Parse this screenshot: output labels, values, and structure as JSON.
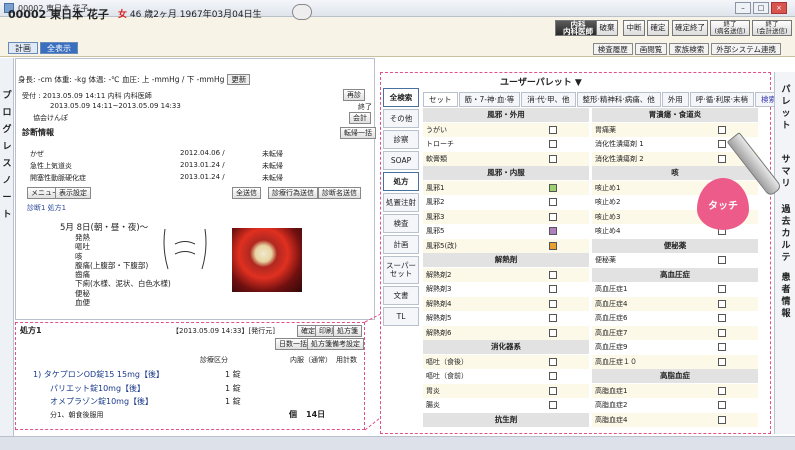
{
  "window": {
    "title": "00002 東日本 花子"
  },
  "patient": {
    "id_name": "00002 東日本 花子",
    "sex": "女",
    "age_dob": "46 歳2ヶ月 1967年03月04日生"
  },
  "top_tabs": [
    "計画",
    "全表示"
  ],
  "toolbar": {
    "b0": "内科\n内科医師",
    "b1": "破棄",
    "b2": "中断",
    "b3": "確定",
    "b4": "確定終了",
    "b5": "終了\n(病名送信)",
    "b6": "終了\n(会計送信)"
  },
  "ext_buttons": [
    "検査履歴",
    "画閲覧",
    "家族検索",
    "外部システム連携"
  ],
  "left_strip": "プログレスノート",
  "vitals": {
    "text": "身長: -cm  体重: -kg  体温: -℃  血圧: 上 -mmHg / 下 -mmHg",
    "update": "更新"
  },
  "visit": {
    "line1": "受付 : 2013.05.09 14:11   内科   内科医師",
    "line2": "2013.05.09 14:11~2013.05.09 14:33",
    "line3": "協会けんぽ",
    "end": "終了",
    "kaikei": "会計",
    "prev": "再診"
  },
  "diag": {
    "title": "診断情報",
    "transfer": "転帰一括",
    "rows": [
      {
        "name": "かぜ",
        "date": "2012.04.06 /",
        "status": "未転帰"
      },
      {
        "name": "急性上気道炎",
        "date": "2013.01.24 /",
        "status": "未転帰"
      },
      {
        "name": "開塞性動脈硬化症",
        "date": "2013.01.24 /",
        "status": "未転帰"
      }
    ],
    "send": [
      "メニュー",
      "表示設定",
      "全送信",
      "診療行為送信",
      "診断名送信"
    ],
    "tabs": "診断1  処方1"
  },
  "note": {
    "date": "5月 8日(朝・昼・夜)～",
    "items": [
      "発熱",
      "嘔吐",
      "咳",
      "腹痛(上腹部・下腹部)",
      "齒痛",
      "下痢(水様、泥状、白色水様)",
      "便秘",
      "血便"
    ]
  },
  "rx": {
    "title": "処方1",
    "stamp": "【2013.05.09 14:33】[発行元]",
    "buttons": [
      "確定",
      "印刷",
      "処方箋"
    ],
    "buttons2": [
      "日数一括",
      "処方箋備考設定"
    ],
    "header": [
      "診療区分",
      "内服（通常）",
      "用計数"
    ],
    "lines": [
      {
        "name": "1) タケプロンOD錠15  15mg【後】",
        "qty": "1 錠"
      },
      {
        "name": "パリエット錠10mg【後】",
        "qty": "1 錠"
      },
      {
        "name": "オメプラゾン錠10mg【後】",
        "qty": "1 錠"
      },
      {
        "name": "分1、朝食後服用",
        "qty": "14日"
      }
    ],
    "unit": "個"
  },
  "palette": {
    "title": "ユーザーパレット ▼"
  },
  "side_menu": [
    "全検索",
    "その他",
    "診察",
    "SOAP",
    "処方",
    "処置注射",
    "検査",
    "計画",
    "スーパーセット",
    "文書",
    "TL"
  ],
  "palette_tabs": [
    "セット",
    "筋・7-神·血·等",
    "消·代·甲、他",
    "整形·精神科·病痛、他",
    "外用",
    "呼·循·利尿·末梢",
    "検索"
  ],
  "left_col": [
    {
      "t": "hdr",
      "label": "風邪・外用"
    },
    {
      "t": "row",
      "label": "うがい",
      "cb": ""
    },
    {
      "t": "row",
      "label": "トローチ",
      "cb": ""
    },
    {
      "t": "row",
      "label": "軟膏類",
      "cb": ""
    },
    {
      "t": "hdr",
      "label": "風邪・内服"
    },
    {
      "t": "row",
      "label": "風邪1",
      "cb": "green"
    },
    {
      "t": "row",
      "label": "風邪2",
      "cb": ""
    },
    {
      "t": "row",
      "label": "風邪3",
      "cb": ""
    },
    {
      "t": "row",
      "label": "風邪5",
      "cb": "purple"
    },
    {
      "t": "row",
      "label": "風邪5(改)",
      "cb": "orange"
    },
    {
      "t": "hdr",
      "label": "解熱剤"
    },
    {
      "t": "row",
      "label": "解熱剤2",
      "cb": ""
    },
    {
      "t": "row",
      "label": "解熱剤3",
      "cb": ""
    },
    {
      "t": "row",
      "label": "解熱剤4",
      "cb": ""
    },
    {
      "t": "row",
      "label": "解熱剤5",
      "cb": ""
    },
    {
      "t": "row",
      "label": "解熱剤6",
      "cb": ""
    },
    {
      "t": "hdr",
      "label": "消化器系"
    },
    {
      "t": "row",
      "label": "嘔吐（食後）",
      "cb": ""
    },
    {
      "t": "row",
      "label": "嘔吐（食前）",
      "cb": ""
    },
    {
      "t": "row",
      "label": "胃炎",
      "cb": ""
    },
    {
      "t": "row",
      "label": "腸炎",
      "cb": ""
    },
    {
      "t": "hdr",
      "label": "抗生剤"
    }
  ],
  "right_col": [
    {
      "t": "hdr",
      "label": "胃潰瘍・食道炎"
    },
    {
      "t": "row",
      "label": "胃痛薬",
      "cb": ""
    },
    {
      "t": "row",
      "label": "消化性潰瘍剤 1",
      "cb": ""
    },
    {
      "t": "row",
      "label": "消化性潰瘍剤 2",
      "cb": ""
    },
    {
      "t": "hdr",
      "label": "咳"
    },
    {
      "t": "row",
      "label": "咳止め1",
      "cb": ""
    },
    {
      "t": "row",
      "label": "咳止め2",
      "cb": ""
    },
    {
      "t": "row",
      "label": "咳止め3",
      "cb": ""
    },
    {
      "t": "row",
      "label": "咳止め4",
      "cb": ""
    },
    {
      "t": "hdr",
      "label": "便秘薬"
    },
    {
      "t": "row",
      "label": "便秘薬",
      "cb": ""
    },
    {
      "t": "hdr",
      "label": "高血圧症"
    },
    {
      "t": "row",
      "label": "高血圧症1",
      "cb": ""
    },
    {
      "t": "row",
      "label": "高血圧症4",
      "cb": ""
    },
    {
      "t": "row",
      "label": "高血圧症6",
      "cb": ""
    },
    {
      "t": "row",
      "label": "高血圧症7",
      "cb": ""
    },
    {
      "t": "row",
      "label": "高血圧症9",
      "cb": ""
    },
    {
      "t": "row",
      "label": "高血圧症１０",
      "cb": ""
    },
    {
      "t": "hdr",
      "label": "高脂血症"
    },
    {
      "t": "row",
      "label": "高脂血症1",
      "cb": ""
    },
    {
      "t": "row",
      "label": "高脂血症2",
      "cb": ""
    },
    {
      "t": "row",
      "label": "高脂血症4",
      "cb": ""
    }
  ],
  "touch_label": "タッチ",
  "right_strip": [
    "パレット",
    "サマリ",
    "過去カルテ",
    "患者情報"
  ]
}
